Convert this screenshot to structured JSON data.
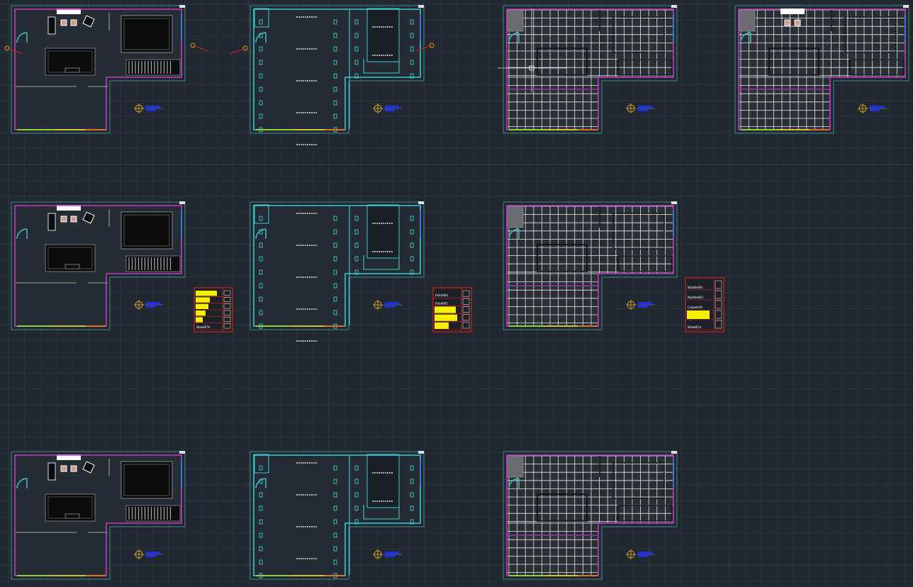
{
  "colors": {
    "background": "#212830",
    "grid_minor": "#283039",
    "grid_major": "#2f3843",
    "outline": "#3f8a8a",
    "wall_magenta": "#c03cc8",
    "wall_cyan": "#3fc8d0",
    "furniture": "#0a0d10",
    "tile_white": "#e8e8e8",
    "legend_red": "#d02020",
    "legend_yellow": "#f4f000",
    "tag_blue": "#2030e0",
    "marker_orange": "#c89a2a"
  },
  "view_types": [
    "furniture-plan",
    "ceiling-plan",
    "floor-tile-plan",
    "floor-tile-plan-with-furniture"
  ],
  "legends": [
    {
      "name": "legend-furniture",
      "items": [
        "Metal078"
      ]
    },
    {
      "name": "legend-ceiling",
      "items": [
        "Paint004",
        "Paint005"
      ]
    },
    {
      "name": "legend-floor",
      "items": [
        "Marble001",
        "Marble002",
        "Carpet010",
        "Metal054"
      ]
    }
  ]
}
